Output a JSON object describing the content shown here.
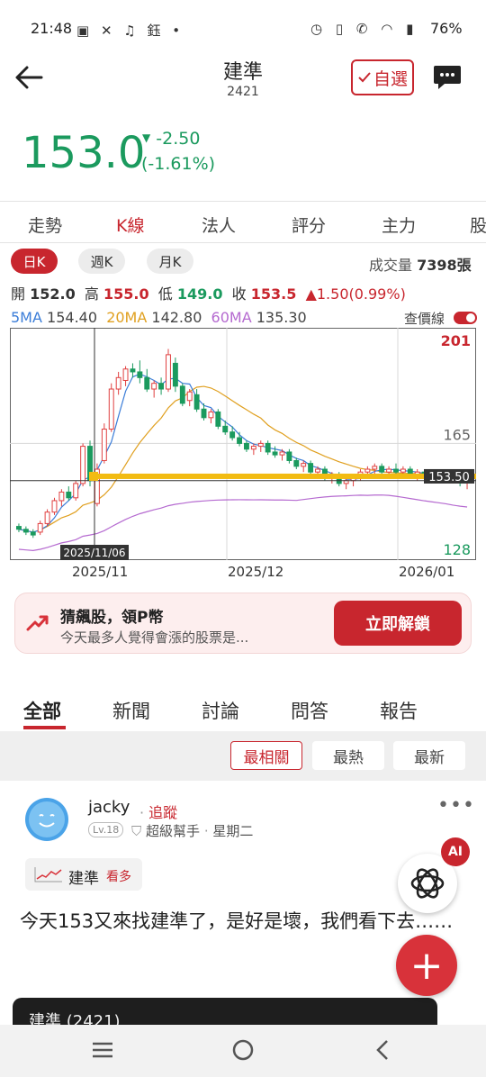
{
  "status_bar": {
    "time": "21:48",
    "battery": "76%"
  },
  "header": {
    "title": "建準",
    "code": "2421",
    "watch_label": "自選"
  },
  "quote": {
    "price": "153.0",
    "change": "-2.50",
    "change_pct": "(-1.61%)"
  },
  "tabs": [
    "走勢",
    "K線",
    "法人",
    "評分",
    "主力",
    "股"
  ],
  "period": {
    "buttons": [
      "日K",
      "週K",
      "月K"
    ],
    "volume_label": "成交量",
    "volume_value": "7398張"
  },
  "ohlc": {
    "open_label": "開",
    "open": "152.0",
    "high_label": "高",
    "high": "155.0",
    "low_label": "低",
    "low": "149.0",
    "close_label": "收",
    "close": "153.5",
    "change": "▲1.50(0.99%)"
  },
  "ma": {
    "ma5_label": "5MA",
    "ma5": "154.40",
    "ma20_label": "20MA",
    "ma20": "142.80",
    "ma60_label": "60MA",
    "ma60": "135.30",
    "price_line_label": "查價線"
  },
  "chart_labels": {
    "ymax": "201",
    "ymid": "165",
    "ymin": "128",
    "cursor_label": "153.50",
    "cursor_date": "2025/11/06",
    "x_ticks": [
      "2025/11",
      "2025/12",
      "2026/01"
    ]
  },
  "chart_data": {
    "type": "candlestick",
    "ylim": [
      128,
      201
    ],
    "x_ticks": [
      "2025/11",
      "2025/12",
      "2026/01"
    ],
    "ohlc": [
      [
        136,
        137,
        134,
        135
      ],
      [
        135,
        136,
        133,
        134
      ],
      [
        134,
        135,
        132,
        133
      ],
      [
        134,
        138,
        133,
        137
      ],
      [
        137,
        142,
        136,
        141
      ],
      [
        141,
        146,
        140,
        145
      ],
      [
        145,
        149,
        143,
        148
      ],
      [
        148,
        150,
        145,
        146
      ],
      [
        146,
        152,
        145,
        151
      ],
      [
        151,
        165,
        150,
        164
      ],
      [
        164,
        166,
        150,
        152
      ],
      [
        144,
        158,
        143,
        156
      ],
      [
        159,
        172,
        158,
        170
      ],
      [
        170,
        186,
        169,
        184
      ],
      [
        184,
        190,
        182,
        188
      ],
      [
        187,
        192,
        185,
        191
      ],
      [
        191,
        193,
        188,
        190
      ],
      [
        190,
        194,
        186,
        188
      ],
      [
        188,
        191,
        183,
        184
      ],
      [
        184,
        187,
        181,
        186
      ],
      [
        186,
        188,
        182,
        184
      ],
      [
        184,
        198,
        183,
        196
      ],
      [
        193,
        195,
        183,
        185
      ],
      [
        185,
        186,
        178,
        179
      ],
      [
        180,
        184,
        178,
        183
      ],
      [
        182,
        184,
        176,
        177
      ],
      [
        177,
        179,
        173,
        174
      ],
      [
        174,
        177,
        172,
        176
      ],
      [
        176,
        177,
        170,
        171
      ],
      [
        171,
        173,
        168,
        169
      ],
      [
        169,
        171,
        166,
        167
      ],
      [
        167,
        169,
        164,
        165
      ],
      [
        165,
        166,
        162,
        163
      ],
      [
        163,
        165,
        161,
        164
      ],
      [
        164,
        166,
        162,
        165
      ],
      [
        165,
        166,
        161,
        162
      ],
      [
        162,
        164,
        160,
        161
      ],
      [
        161,
        163,
        159,
        162
      ],
      [
        162,
        163,
        158,
        159
      ],
      [
        159,
        160,
        156,
        157
      ],
      [
        157,
        159,
        155,
        158
      ],
      [
        158,
        159,
        154,
        155
      ],
      [
        155,
        157,
        153,
        156
      ],
      [
        156,
        157,
        152,
        153
      ],
      [
        153,
        155,
        151,
        154
      ],
      [
        154,
        155,
        150,
        151
      ],
      [
        151,
        153,
        149,
        152
      ],
      [
        152,
        154,
        150,
        153
      ],
      [
        153,
        156,
        152,
        155
      ],
      [
        155,
        157,
        153,
        156
      ],
      [
        156,
        158,
        154,
        157
      ],
      [
        157,
        158,
        154,
        155
      ],
      [
        155,
        157,
        153,
        156
      ],
      [
        156,
        158,
        154,
        155
      ],
      [
        155,
        157,
        153,
        156
      ],
      [
        156,
        157,
        153,
        154
      ],
      [
        154,
        156,
        152,
        155
      ],
      [
        155,
        156,
        152,
        153
      ],
      [
        153,
        155,
        151,
        154
      ],
      [
        154,
        156,
        152,
        155
      ],
      [
        155,
        156,
        152,
        153
      ],
      [
        153,
        155,
        151,
        154
      ],
      [
        154,
        155,
        150,
        153
      ],
      [
        152,
        155,
        149,
        153.5
      ]
    ],
    "cursor_price": 153.5
  },
  "promo": {
    "title": "猜飆股，領P幣",
    "subtitle": "今天最多人覺得會漲的股票是...",
    "button": "立即解鎖"
  },
  "news_tabs": [
    "全部",
    "新聞",
    "討論",
    "問答",
    "報告"
  ],
  "sort": [
    "最相關",
    "最熱",
    "最新"
  ],
  "post": {
    "user": "jacky",
    "follow": "追蹤",
    "level": "Lv.18",
    "role": "超級幫手",
    "time": "星期二",
    "tag_name": "建準",
    "tag_link": "看多",
    "content": "今天153又來找建準了，是好是壞，我們看下去……",
    "card_title": "建準 (2421)"
  },
  "ai_badge": "AI"
}
